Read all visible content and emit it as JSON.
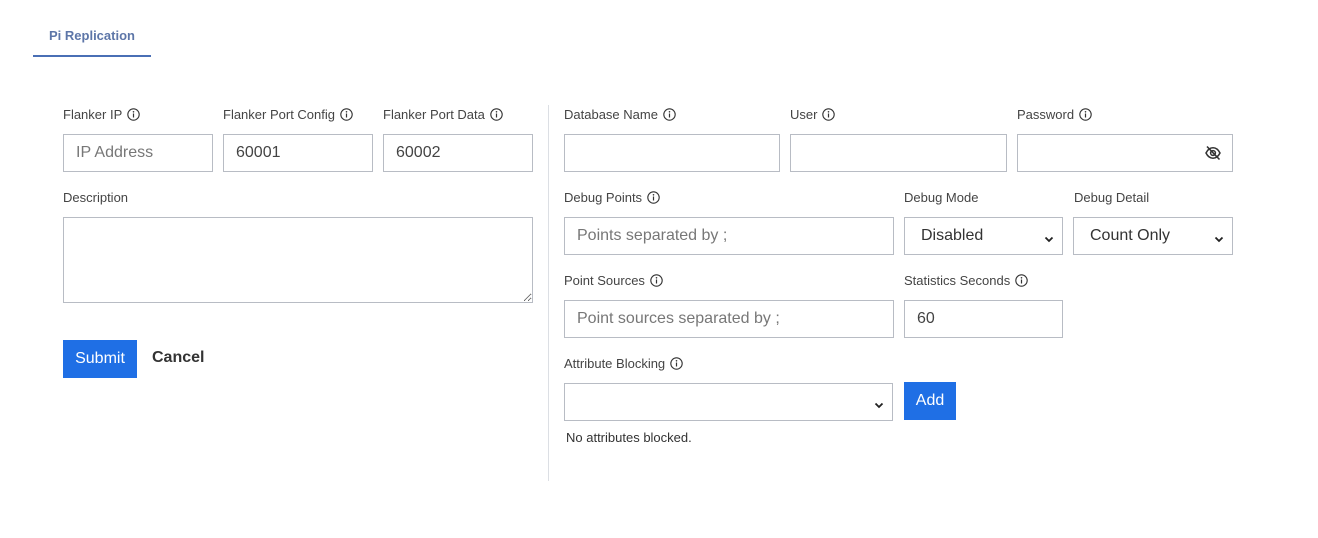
{
  "tabs": [
    {
      "label": "Pi Replication",
      "active": true
    }
  ],
  "left": {
    "flanker_ip": {
      "label": "Flanker IP",
      "value": "",
      "placeholder": "IP Address"
    },
    "port_config": {
      "label": "Flanker Port Config",
      "value": "60001"
    },
    "port_data": {
      "label": "Flanker Port Data",
      "value": "60002"
    },
    "description": {
      "label": "Description",
      "value": ""
    },
    "submit_label": "Submit",
    "cancel_label": "Cancel"
  },
  "right": {
    "database_name": {
      "label": "Database Name",
      "value": ""
    },
    "user": {
      "label": "User",
      "value": ""
    },
    "password": {
      "label": "Password",
      "value": ""
    },
    "debug_points": {
      "label": "Debug Points",
      "placeholder": "Points separated by ;"
    },
    "debug_mode": {
      "label": "Debug Mode",
      "selected": "Disabled"
    },
    "debug_detail": {
      "label": "Debug Detail",
      "selected": "Count Only"
    },
    "point_sources": {
      "label": "Point Sources",
      "placeholder": "Point sources separated by ;"
    },
    "statistics_seconds": {
      "label": "Statistics Seconds",
      "value": "60"
    },
    "attribute_blocking": {
      "label": "Attribute Blocking",
      "selected": ""
    },
    "add_label": "Add",
    "status": "No attributes blocked."
  },
  "colors": {
    "accent": "#1f6fe5",
    "tab_underline": "#4a6fb5"
  },
  "icons": [
    "info-icon",
    "eye-off-icon",
    "chevron-down-icon"
  ]
}
